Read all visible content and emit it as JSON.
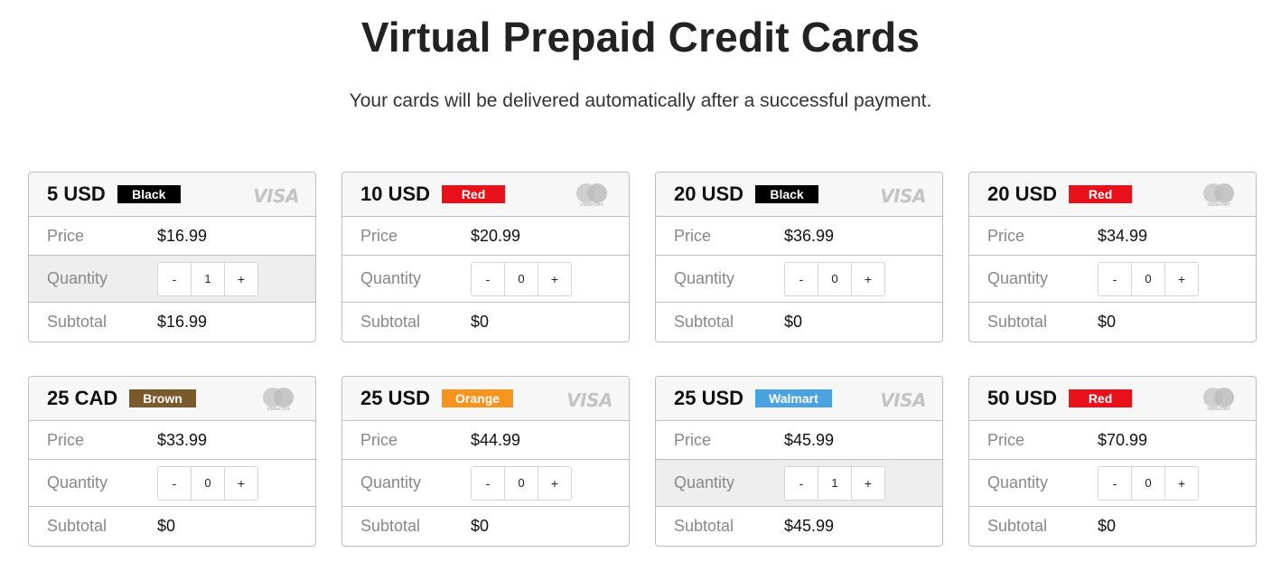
{
  "page": {
    "title": "Virtual Prepaid Credit Cards",
    "subtitle": "Your cards will be delivered automatically after a successful payment."
  },
  "labels": {
    "price": "Price",
    "quantity": "Quantity",
    "subtotal": "Subtotal",
    "minus": "-",
    "plus": "+",
    "visa": "VISA",
    "mastercard": "mastercard"
  },
  "colors": {
    "Black": "#000000",
    "Red": "#e8101a",
    "Brown": "#7a5a2c",
    "Orange": "#f7941d",
    "Walmart": "#4aa3df"
  },
  "cards": [
    {
      "amount": "5 USD",
      "badge": "Black",
      "brand": "visa",
      "price": "$16.99",
      "quantity": "1",
      "subtotal": "$16.99",
      "highlight": true
    },
    {
      "amount": "10 USD",
      "badge": "Red",
      "brand": "mastercard",
      "price": "$20.99",
      "quantity": "0",
      "subtotal": "$0",
      "highlight": false
    },
    {
      "amount": "20 USD",
      "badge": "Black",
      "brand": "visa",
      "price": "$36.99",
      "quantity": "0",
      "subtotal": "$0",
      "highlight": false
    },
    {
      "amount": "20 USD",
      "badge": "Red",
      "brand": "mastercard",
      "price": "$34.99",
      "quantity": "0",
      "subtotal": "$0",
      "highlight": false
    },
    {
      "amount": "25 CAD",
      "badge": "Brown",
      "brand": "mastercard",
      "price": "$33.99",
      "quantity": "0",
      "subtotal": "$0",
      "highlight": false
    },
    {
      "amount": "25 USD",
      "badge": "Orange",
      "brand": "visa",
      "price": "$44.99",
      "quantity": "0",
      "subtotal": "$0",
      "highlight": false
    },
    {
      "amount": "25 USD",
      "badge": "Walmart",
      "brand": "visa",
      "price": "$45.99",
      "quantity": "1",
      "subtotal": "$45.99",
      "highlight": true
    },
    {
      "amount": "50 USD",
      "badge": "Red",
      "brand": "mastercard",
      "price": "$70.99",
      "quantity": "0",
      "subtotal": "$0",
      "highlight": false
    }
  ]
}
